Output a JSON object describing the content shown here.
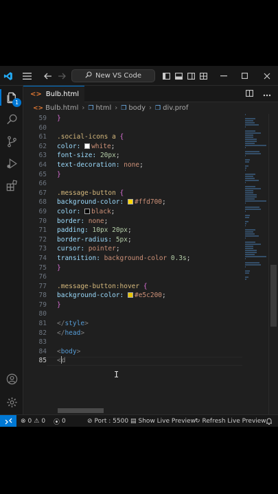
{
  "window": {
    "search_text": "New VS Code",
    "icons": [
      "vscode-logo",
      "menu",
      "back-arrow",
      "forward-arrow",
      "search",
      "toggle-primary-sidebar",
      "toggle-panel",
      "toggle-secondary-sidebar",
      "customize-layout",
      "minimize",
      "maximize",
      "close"
    ]
  },
  "activity_bar": {
    "badge_count": "1",
    "icons": [
      "explorer",
      "search",
      "source-control",
      "run-and-debug",
      "extensions",
      "accounts",
      "manage"
    ]
  },
  "tab": {
    "icon_text": "<>",
    "filename": "Bulb.html"
  },
  "breadcrumb": [
    "Bulb.html",
    "html",
    "body",
    "div.prof"
  ],
  "editor": {
    "current_line": "85",
    "lines": [
      {
        "n": "59",
        "text": "}"
      },
      {
        "n": "60",
        "text": ""
      },
      {
        "n": "61",
        "text": ".social-icons a {"
      },
      {
        "n": "62",
        "text": "color: white;",
        "prop": "color:",
        "swatch": "#ffffff",
        "value": "white"
      },
      {
        "n": "63",
        "text": "font-size: 20px;"
      },
      {
        "n": "64",
        "text": "text-decoration: none;"
      },
      {
        "n": "65",
        "text": "}"
      },
      {
        "n": "66",
        "text": ""
      },
      {
        "n": "67",
        "text": ".message-button {"
      },
      {
        "n": "68",
        "text": "background-color: #ffd700;",
        "prop": "background-color:",
        "swatch": "#ffd700",
        "value": "#ffd700"
      },
      {
        "n": "69",
        "text": "color: black;",
        "prop": "color:",
        "swatch": "#000000",
        "value": "black"
      },
      {
        "n": "70",
        "text": "border: none;"
      },
      {
        "n": "71",
        "text": "padding: 10px 20px;"
      },
      {
        "n": "72",
        "text": "border-radius: 5px;"
      },
      {
        "n": "73",
        "text": "cursor: pointer;"
      },
      {
        "n": "74",
        "text": "transition: background-color 0.3s;"
      },
      {
        "n": "75",
        "text": "}"
      },
      {
        "n": "76",
        "text": ""
      },
      {
        "n": "77",
        "text": ".message-button:hover {"
      },
      {
        "n": "78",
        "text": "background-color: #e5c200;",
        "prop": "background-color:",
        "swatch": "#e5c200",
        "value": "#e5c200"
      },
      {
        "n": "79",
        "text": "}"
      },
      {
        "n": "80",
        "text": ""
      },
      {
        "n": "81",
        "text": "</style>"
      },
      {
        "n": "82",
        "text": "</head>"
      },
      {
        "n": "83",
        "text": ""
      },
      {
        "n": "84",
        "text": "<body>"
      },
      {
        "n": "85",
        "text": "<d"
      }
    ]
  },
  "status_bar": {
    "errors": "0",
    "warnings": "0",
    "ports": "0",
    "port_label": "Port : 5500",
    "show_preview": "Show Live Preview",
    "refresh_preview": "Refresh Live Preview"
  },
  "colors": {
    "accent": "#0078d4",
    "editor_bg": "#1f1f1f",
    "chrome_bg": "#181818",
    "html_icon": "#e37933"
  }
}
